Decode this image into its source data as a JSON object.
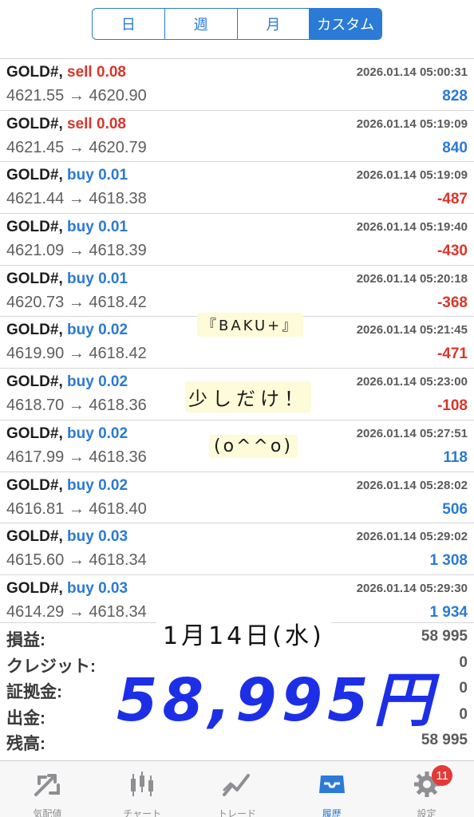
{
  "period_tabs": [
    {
      "label": "日",
      "active": false
    },
    {
      "label": "週",
      "active": false
    },
    {
      "label": "月",
      "active": false
    },
    {
      "label": "カスタム",
      "active": true
    }
  ],
  "deals": [
    {
      "symbol": "GOLD#,",
      "side": "sell",
      "volume": "0.08",
      "time": "2026.01.14 05:00:31",
      "prices": "4621.55 → 4620.90",
      "profit": "828"
    },
    {
      "symbol": "GOLD#,",
      "side": "sell",
      "volume": "0.08",
      "time": "2026.01.14 05:19:09",
      "prices": "4621.45 → 4620.79",
      "profit": "840"
    },
    {
      "symbol": "GOLD#,",
      "side": "buy",
      "volume": "0.01",
      "time": "2026.01.14 05:19:09",
      "prices": "4621.44 → 4618.38",
      "profit": "-487"
    },
    {
      "symbol": "GOLD#,",
      "side": "buy",
      "volume": "0.01",
      "time": "2026.01.14 05:19:40",
      "prices": "4621.09 → 4618.39",
      "profit": "-430"
    },
    {
      "symbol": "GOLD#,",
      "side": "buy",
      "volume": "0.01",
      "time": "2026.01.14 05:20:18",
      "prices": "4620.73 → 4618.42",
      "profit": "-368"
    },
    {
      "symbol": "GOLD#,",
      "side": "buy",
      "volume": "0.02",
      "time": "2026.01.14 05:21:45",
      "prices": "4619.90 → 4618.42",
      "profit": "-471"
    },
    {
      "symbol": "GOLD#,",
      "side": "buy",
      "volume": "0.02",
      "time": "2026.01.14 05:23:00",
      "prices": "4618.70 → 4618.36",
      "profit": "-108"
    },
    {
      "symbol": "GOLD#,",
      "side": "buy",
      "volume": "0.02",
      "time": "2026.01.14 05:27:51",
      "prices": "4617.99 → 4618.36",
      "profit": "118"
    },
    {
      "symbol": "GOLD#,",
      "side": "buy",
      "volume": "0.02",
      "time": "2026.01.14 05:28:02",
      "prices": "4616.81 → 4618.40",
      "profit": "506"
    },
    {
      "symbol": "GOLD#,",
      "side": "buy",
      "volume": "0.03",
      "time": "2026.01.14 05:29:02",
      "prices": "4615.60 → 4618.34",
      "profit": "1 308"
    },
    {
      "symbol": "GOLD#,",
      "side": "buy",
      "volume": "0.03",
      "time": "2026.01.14 05:29:30",
      "prices": "4614.29 → 4618.34",
      "profit": "1 934"
    }
  ],
  "summary": [
    {
      "label": "損益:",
      "value": "58 995"
    },
    {
      "label": "クレジット:",
      "value": "0"
    },
    {
      "label": "証拠金:",
      "value": "0"
    },
    {
      "label": "出金:",
      "value": "0"
    },
    {
      "label": "残高:",
      "value": "58 995"
    }
  ],
  "handwriting": {
    "baku": "『BAKU+』",
    "sukoshi": "少しだけ！",
    "face": "(o^^o)",
    "date": "1月14日(水)",
    "amount": "58,995円"
  },
  "tabs": [
    {
      "label": "気配値",
      "icon": "quotes-icon",
      "active": false
    },
    {
      "label": "チャート",
      "icon": "chart-icon",
      "active": false
    },
    {
      "label": "トレード",
      "icon": "trade-icon",
      "active": false
    },
    {
      "label": "履歴",
      "icon": "history-icon",
      "active": true
    },
    {
      "label": "設定",
      "icon": "gear-icon",
      "active": false,
      "badge": "11"
    }
  ],
  "colors": {
    "accent": "#2a7ad6",
    "sell": "#d9352a",
    "negative": "#d9352a",
    "positive": "#2a7ad6",
    "handwriting_amount": "#1d2fe6",
    "badge": "#e53935"
  }
}
